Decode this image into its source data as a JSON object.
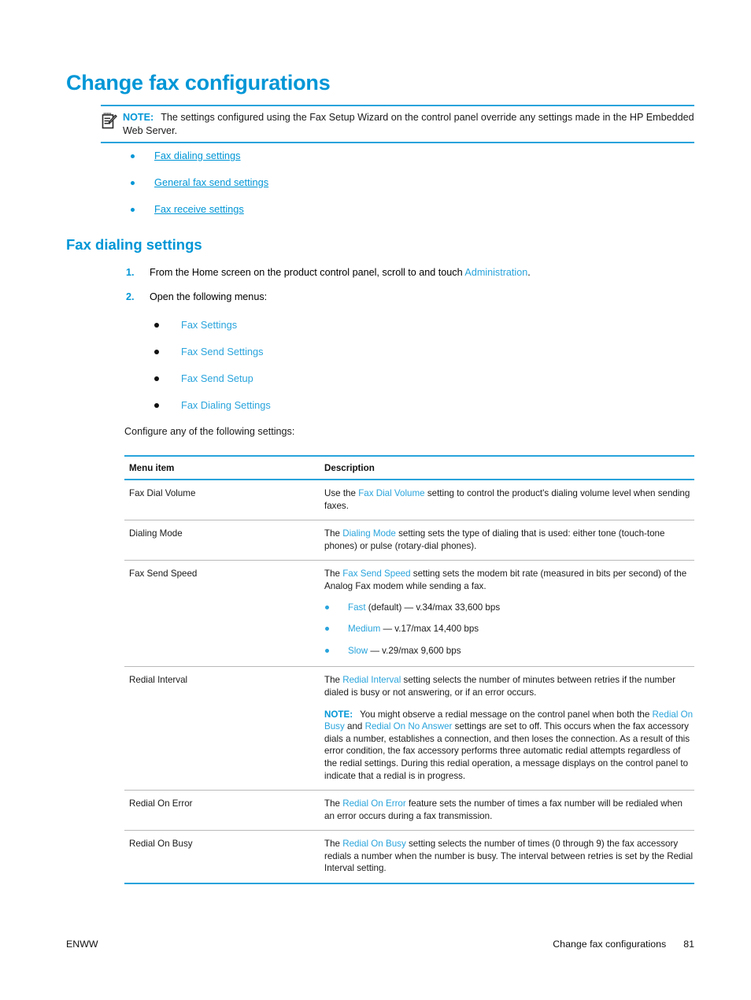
{
  "document": {
    "title": "Change fax configurations"
  },
  "note": {
    "icon": "note-clipboard-pencil-icon",
    "label": "NOTE:",
    "text": "The settings configured using the Fax Setup Wizard on the control panel override any settings made in the HP Embedded Web Server."
  },
  "link_list": [
    {
      "label": "Fax dialing settings"
    },
    {
      "label": "General fax send settings"
    },
    {
      "label": "Fax receive settings"
    }
  ],
  "section": {
    "heading": "Fax dialing settings"
  },
  "steps": [
    {
      "number": "1.",
      "text_before": "From the Home screen on the product control panel, scroll to and touch ",
      "link": "Administration",
      "text_after": "."
    },
    {
      "number": "2.",
      "text_before": "Open the following menus:",
      "link": "",
      "text_after": ""
    }
  ],
  "menu_path": [
    {
      "label": "Fax Settings"
    },
    {
      "label": "Fax Send Settings"
    },
    {
      "label": "Fax Send Setup"
    },
    {
      "label": "Fax Dialing Settings"
    }
  ],
  "configure_line": "Configure any of the following settings:",
  "table": {
    "headers": {
      "menu_item": "Menu item",
      "description": "Description"
    },
    "rows": [
      {
        "menu_item": "Fax Dial Volume",
        "desc_part1": "Use the ",
        "desc_link1": "Fax Dial Volume",
        "desc_part2": " setting to control the product's dialing volume level when sending faxes."
      },
      {
        "menu_item": "Dialing Mode",
        "desc_part1": "The ",
        "desc_link1": "Dialing Mode",
        "desc_part2": " setting sets the type of dialing that is used: either tone (touch-tone phones) or pulse (rotary-dial phones)."
      },
      {
        "menu_item": "Fax Send Speed",
        "desc_part1": "The ",
        "desc_link1": "Fax Send Speed",
        "desc_part2": " setting sets the modem bit rate (measured in bits per second) of the Analog Fax modem while sending a fax.",
        "speed_options": [
          {
            "name": "Fast",
            "detail": " (default) — v.34/max 33,600 bps"
          },
          {
            "name": "Medium",
            "detail": " — v.17/max 14,400 bps"
          },
          {
            "name": "Slow",
            "detail": " — v.29/max 9,600 bps"
          }
        ]
      },
      {
        "menu_item": "Redial Interval",
        "desc_part1": "The ",
        "desc_link1": "Redial Interval",
        "desc_part2": " setting selects the number of minutes between retries if the number dialed is busy or not answering, or if an error occurs.",
        "inner_note": {
          "label": "NOTE:",
          "text_a": "You might observe a redial message on the control panel when both the ",
          "link_a": "Redial On Busy",
          "text_b": " and ",
          "link_b": "Redial On No Answer",
          "text_c": " settings are set to off. This occurs when the fax accessory dials a number, establishes a connection, and then loses the connection. As a result of this error condition, the fax accessory performs three automatic redial attempts regardless of the redial settings. During this redial operation, a message displays on the control panel to indicate that a redial is in progress."
        }
      },
      {
        "menu_item": "Redial On Error",
        "desc_part1": "The ",
        "desc_link1": "Redial On Error",
        "desc_part2": " feature sets the number of times a fax number will be redialed when an error occurs during a fax transmission."
      },
      {
        "menu_item": "Redial On Busy",
        "desc_part1": "The ",
        "desc_link1": "Redial On Busy",
        "desc_part2": " setting selects the number of times (0 through 9) the fax accessory redials a number when the number is busy. The interval between retries is set by the Redial Interval setting."
      }
    ]
  },
  "footer": {
    "left": "ENWW",
    "right": "Change fax configurations",
    "page_number": "81"
  },
  "colors": {
    "accent_blue": "#0096d6",
    "link_blue": "#29a4dc",
    "rule_blue": "#29a4dc",
    "text_black": "#1a1a1a"
  }
}
